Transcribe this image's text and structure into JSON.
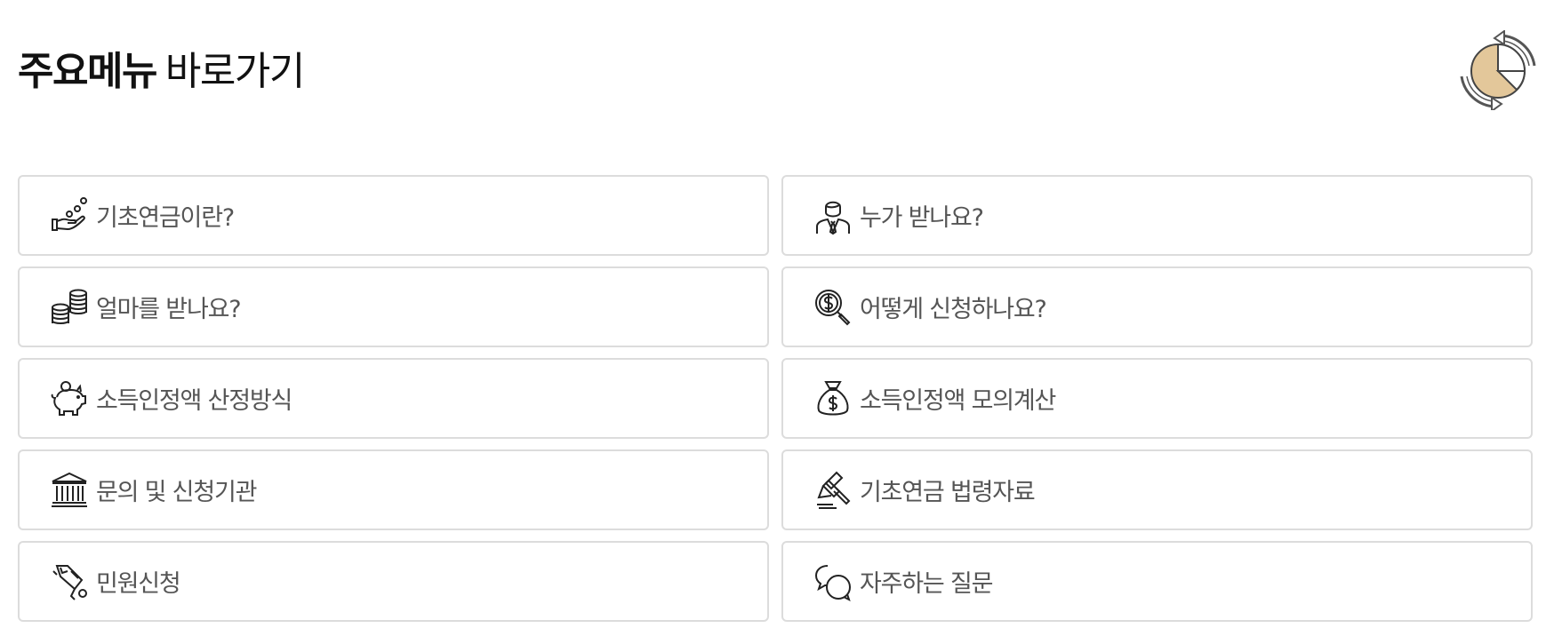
{
  "header": {
    "title_strong": "주요메뉴",
    "title_light": "바로가기"
  },
  "refresh_icon": "refresh-chart-icon",
  "colors": {
    "accent_fill": "#e3c79a",
    "border": "#dcdcdc",
    "label": "#555555",
    "title": "#111111"
  },
  "menu": [
    {
      "label": "기초연금이란?",
      "icon": "hand-coins-icon"
    },
    {
      "label": "누가 받나요?",
      "icon": "person-suit-icon"
    },
    {
      "label": "얼마를 받나요?",
      "icon": "coin-stack-icon"
    },
    {
      "label": "어떻게 신청하나요?",
      "icon": "dollar-magnifier-icon"
    },
    {
      "label": "소득인정액 산정방식",
      "icon": "piggy-bank-icon"
    },
    {
      "label": "소득인정액 모의계산",
      "icon": "money-bag-icon"
    },
    {
      "label": "문의 및 신청기관",
      "icon": "bank-building-icon"
    },
    {
      "label": "기초연금 법령자료",
      "icon": "gavel-icon"
    },
    {
      "label": "민원신청",
      "icon": "pen-sign-icon"
    },
    {
      "label": "자주하는 질문",
      "icon": "chat-bubbles-icon"
    }
  ]
}
